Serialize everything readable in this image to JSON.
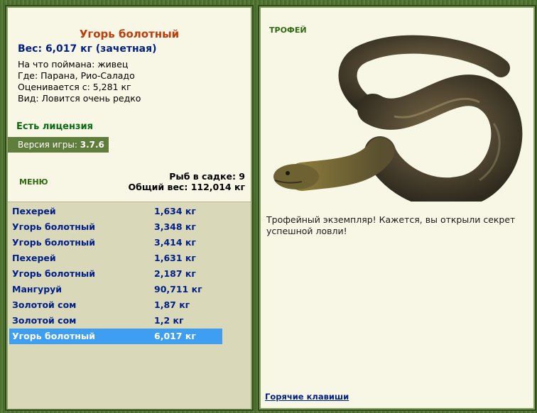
{
  "catch": {
    "title": "Угорь болотный",
    "weight_line": "Вес: 6,017 кг (зачетная)",
    "bait_line": "На что поймана: живец",
    "location_line": "Где: Парана, Рио-Саладо",
    "value_line": "Оценивается с: 5,281 кг",
    "type_line": "Вид: Ловится очень редко"
  },
  "license": "Есть лицензия",
  "version": {
    "label": "Версия игры:",
    "value": "3.7.6"
  },
  "menu_label": "МЕНЮ",
  "stats": {
    "fish_count": "Рыб в садке: 9",
    "total_weight": "Общий вес: 112,014 кг"
  },
  "fish_list": [
    {
      "name": "Пехерей",
      "weight": "1,634 кг"
    },
    {
      "name": "Угорь болотный",
      "weight": "3,348 кг"
    },
    {
      "name": "Угорь болотный",
      "weight": "3,414 кг"
    },
    {
      "name": "Пехерей",
      "weight": "1,631 кг"
    },
    {
      "name": "Угорь болотный",
      "weight": "2,187 кг"
    },
    {
      "name": "Мангуруй",
      "weight": "90,711 кг"
    },
    {
      "name": "Золотой сом",
      "weight": "1,87 кг"
    },
    {
      "name": "Золотой сом",
      "weight": "1,2 кг"
    },
    {
      "name": "Угорь болотный",
      "weight": "6,017 кг",
      "selected": true
    }
  ],
  "trophy": {
    "label": "ТРОФЕЙ",
    "text": "Трофейный экземпляр! Кажется, вы открыли секрет успешной ловли!"
  },
  "hotkeys_label": "Горячие клавиши",
  "colors": {
    "accent_green": "#5f7d3b",
    "selected_row": "#3d9ef2",
    "title_orange": "#bf3b0c"
  },
  "icons": {
    "fish_image": "eel-image"
  }
}
